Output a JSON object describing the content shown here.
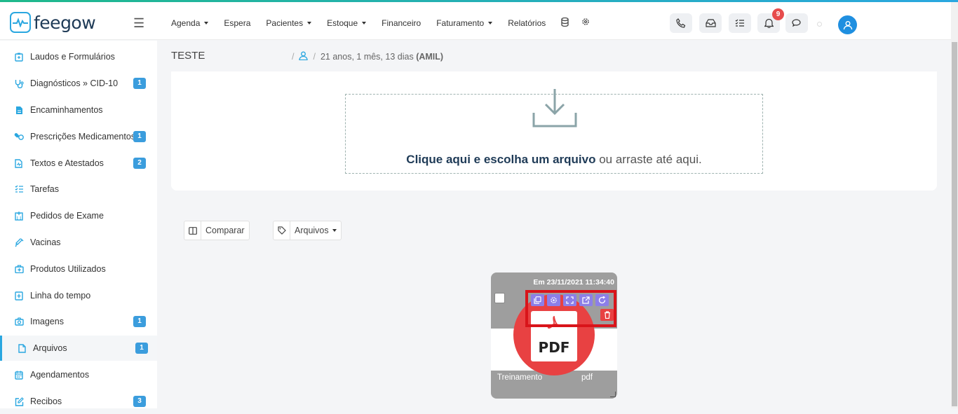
{
  "brand": {
    "name": "feegow"
  },
  "nav": [
    {
      "label": "Agenda",
      "dropdown": true
    },
    {
      "label": "Espera",
      "dropdown": false
    },
    {
      "label": "Pacientes",
      "dropdown": true
    },
    {
      "label": "Estoque",
      "dropdown": true
    },
    {
      "label": "Financeiro",
      "dropdown": false
    },
    {
      "label": "Faturamento",
      "dropdown": true
    },
    {
      "label": "Relatórios",
      "dropdown": false
    }
  ],
  "toolbar": {
    "notifications_count": "9"
  },
  "sidebar": {
    "items": [
      {
        "label": "Laudos e Formulários",
        "icon": "clipboard-icon",
        "count": ""
      },
      {
        "label": "Diagnósticos » CID-10",
        "icon": "stethoscope-icon",
        "count": "1"
      },
      {
        "label": "Encaminhamentos",
        "icon": "document-icon",
        "count": ""
      },
      {
        "label": "Prescrições Medicamentosas",
        "icon": "pills-icon",
        "count": "1"
      },
      {
        "label": "Textos e Atestados",
        "icon": "medical-file-icon",
        "count": "2"
      },
      {
        "label": "Tarefas",
        "icon": "tasks-icon",
        "count": ""
      },
      {
        "label": "Pedidos de Exame",
        "icon": "hospital-icon",
        "count": ""
      },
      {
        "label": "Vacinas",
        "icon": "syringe-icon",
        "count": ""
      },
      {
        "label": "Produtos Utilizados",
        "icon": "medkit-icon",
        "count": ""
      },
      {
        "label": "Linha do tempo",
        "icon": "timeline-icon",
        "count": ""
      },
      {
        "label": "Imagens",
        "icon": "camera-icon",
        "count": "1"
      },
      {
        "label": "Arquivos",
        "icon": "file-icon",
        "count": "1",
        "active": true
      },
      {
        "label": "Agendamentos",
        "icon": "calendar-icon",
        "count": ""
      },
      {
        "label": "Recibos",
        "icon": "edit-icon",
        "count": "3"
      }
    ]
  },
  "patient": {
    "name": "TESTE",
    "age": "21 anos, 1 mês, 13 dias",
    "plan": "(AMIL)"
  },
  "upload": {
    "action": "Clique aqui e escolha um arquivo",
    "rest": " ou arraste até aqui."
  },
  "tools": {
    "compare_label": "Comparar",
    "filter_label": "Arquivos"
  },
  "file": {
    "date": "Em 23/11/2021 11:34:40",
    "badge": "PDF",
    "name": "Treinamento",
    "ext": "pdf"
  },
  "colors": {
    "accent": "#2aa7e0",
    "badge": "#3b9ddd",
    "action": "#8c7fe8",
    "danger": "#e84142",
    "highlight": "#d9141a"
  }
}
